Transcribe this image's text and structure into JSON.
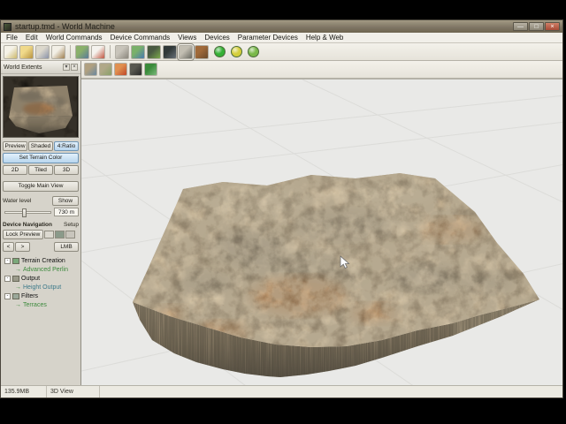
{
  "window": {
    "title": "startup.tmd - World Machine",
    "controls": [
      {
        "name": "minimize-button",
        "glyph": "—"
      },
      {
        "name": "maximize-button",
        "glyph": "□"
      },
      {
        "name": "close-button",
        "glyph": "×"
      }
    ]
  },
  "menu": {
    "items": [
      "File",
      "Edit",
      "World Commands",
      "Device Commands",
      "Views",
      "Devices",
      "Parameter Devices",
      "Help & Web"
    ]
  },
  "toolbar_main": {
    "icons": [
      {
        "name": "new-world-icon",
        "c1": "#f5f2e8",
        "c2": "#cdb96a"
      },
      {
        "name": "open-file-icon",
        "c1": "#f0d98a",
        "c2": "#b89440"
      },
      {
        "name": "save-file-icon",
        "c1": "#dcd8cc",
        "c2": "#8a92a8"
      },
      {
        "name": "export-icon",
        "c1": "#f2efe6",
        "c2": "#a08050"
      },
      {
        "name": "separator",
        "sep": true
      },
      {
        "name": "layout-view-icon",
        "c1": "#8ab06a",
        "c2": "#5a7a9a"
      },
      {
        "name": "device-workview-icon",
        "c1": "#f5f3ee",
        "c2": "#c05540"
      },
      {
        "name": "separator",
        "sep": true
      },
      {
        "name": "parameter-view-icon",
        "c1": "#c8c4ba",
        "c2": "#8a867c"
      },
      {
        "name": "explorer-view-icon",
        "c1": "#7ab06a",
        "c2": "#4a7ab0"
      },
      {
        "name": "heightfield-view-icon",
        "c1": "#4a5a42",
        "c2": "#7aa84a"
      },
      {
        "name": "mesh-view-icon",
        "c1": "#303838",
        "c2": "#687078"
      },
      {
        "name": "view-3d-icon",
        "c1": "#c2beb2",
        "c2": "#6a6a62",
        "selected": true
      },
      {
        "name": "texture-view-icon",
        "c1": "#a06a3a",
        "c2": "#6a4a2a"
      }
    ],
    "build_buttons": [
      {
        "name": "build-button",
        "color": "#35b035"
      },
      {
        "name": "build-blend-button",
        "color": "#d4ce3a"
      },
      {
        "name": "build-world-button",
        "color": "#7ab84a"
      }
    ]
  },
  "toolbar_view": {
    "icons": [
      {
        "name": "overview-map-icon",
        "c1": "#b0a080",
        "c2": "#6a88a0"
      },
      {
        "name": "perspective-view-icon",
        "c1": "#b0a888",
        "c2": "#88a068"
      },
      {
        "name": "water-display-icon",
        "c1": "#e09050",
        "c2": "#c04828"
      },
      {
        "name": "camera-settings-icon",
        "c1": "#585850",
        "c2": "#282828"
      },
      {
        "name": "edit-terrain-icon",
        "c1": "#3a8a3a",
        "c2": "#7ab87a"
      }
    ]
  },
  "sidebar": {
    "panel_title": "World Extents",
    "panel_buttons": [
      {
        "name": "panel-dropdown-icon",
        "glyph": "▾"
      },
      {
        "name": "panel-close-icon",
        "glyph": "×"
      }
    ],
    "preview_tabs": [
      {
        "label": "Preview"
      },
      {
        "label": "Shaded"
      },
      {
        "label": "4:Ratio"
      }
    ],
    "set_terrain_color_label": "Set Terrain Color",
    "view_buttons": [
      "2D",
      "Tiled",
      "3D"
    ],
    "toggle_main_view_label": "Toggle Main View",
    "water_level_label": "Water level",
    "show_button_label": "Show",
    "water_level_value": "730 m",
    "device_navigation_label": "Device Navigation",
    "setup_label": "Setup",
    "lock_preview_label": "Lock Preview",
    "nav_buttons": [
      "<",
      ">"
    ],
    "lmb_label": "LMB",
    "tree": [
      {
        "label": "Terrain Creation",
        "level": 0,
        "icon": "#7aa87a"
      },
      {
        "label": "Advanced Perlin",
        "level": 1,
        "color": "#3d8a3d"
      },
      {
        "label": "Output",
        "level": 0,
        "icon": "#9a9a8a"
      },
      {
        "label": "Height Output",
        "level": 1,
        "color": "#3d7a8a"
      },
      {
        "label": "Filters",
        "level": 0,
        "icon": "#9aa89a"
      },
      {
        "label": "Terraces",
        "level": 1,
        "color": "#3d8a3d"
      }
    ]
  },
  "statusbar": {
    "memory": "135.9MB",
    "view": "3D View"
  }
}
